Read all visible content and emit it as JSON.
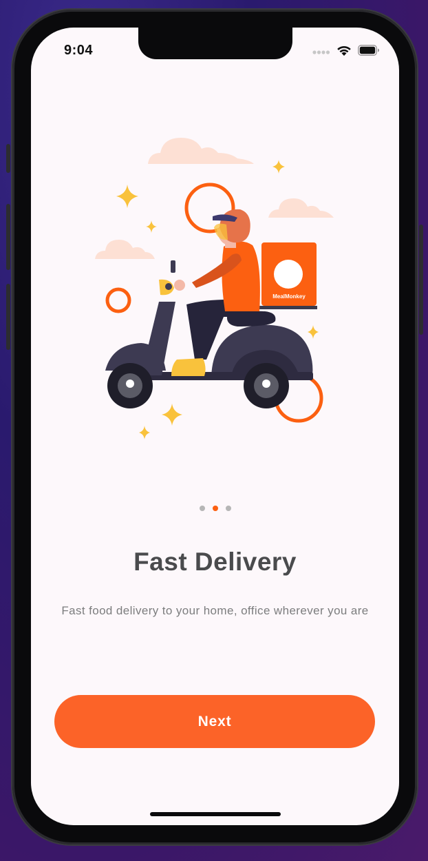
{
  "status_bar": {
    "time": "9:04"
  },
  "illustration": {
    "box_label": "MealMonkey"
  },
  "pagination": {
    "total": 3,
    "active_index": 1
  },
  "onboarding": {
    "title": "Fast Delivery",
    "subtitle": "Fast food delivery to your home, office wherever you are"
  },
  "actions": {
    "next_label": "Next"
  },
  "colors": {
    "accent": "#fc6011",
    "button": "#fc6328",
    "title": "#4a4b4d",
    "subtitle": "#7c7d7e",
    "screen_bg": "#fdf8fb"
  }
}
